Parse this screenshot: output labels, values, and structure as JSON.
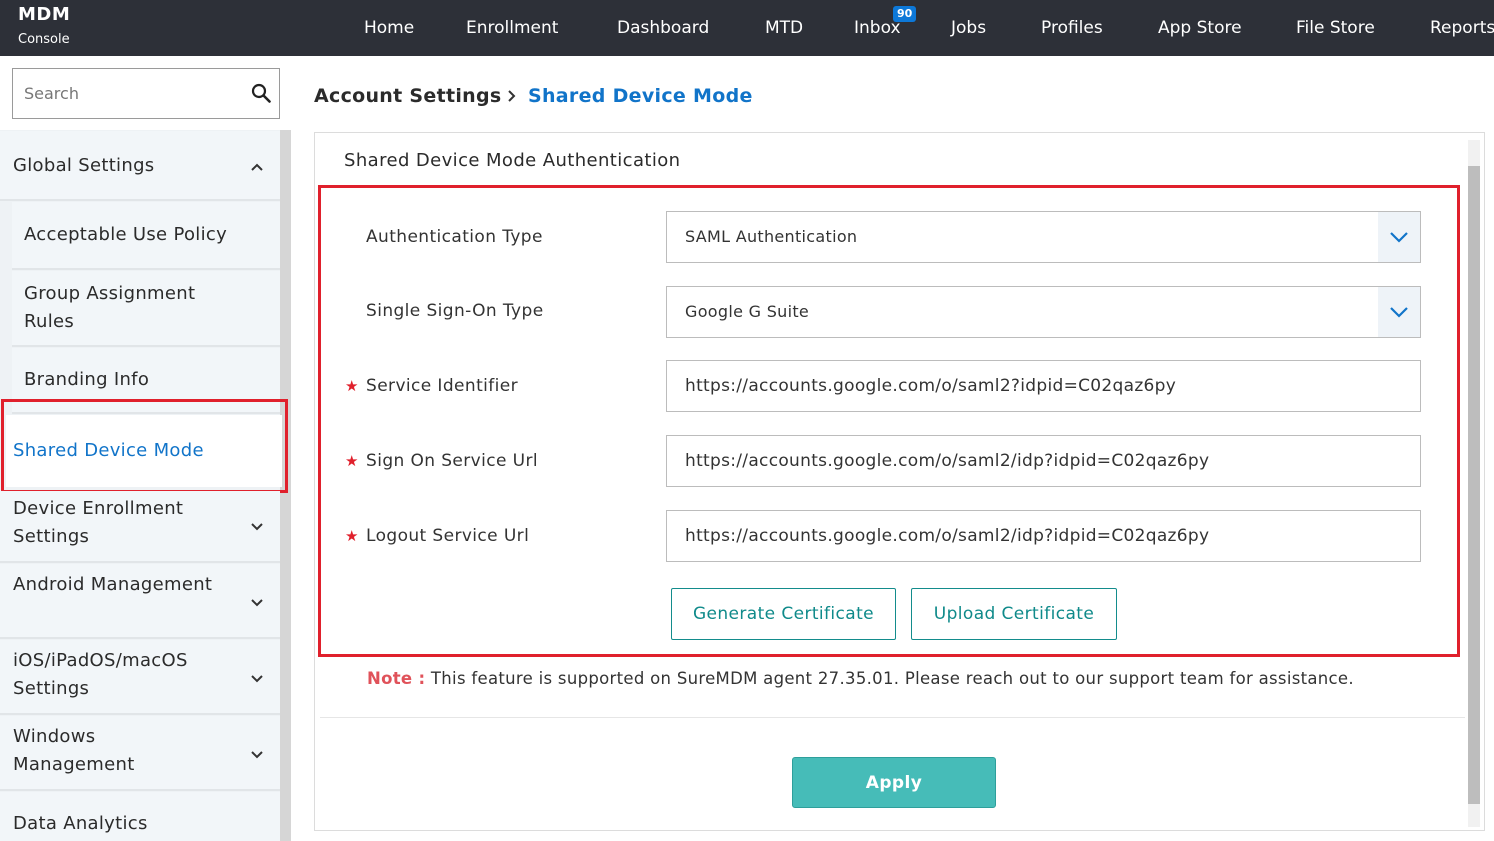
{
  "brand": {
    "title": "MDM",
    "subtitle": "Console"
  },
  "nav": {
    "items": [
      "Home",
      "Enrollment",
      "Dashboard",
      "MTD",
      "Inbox",
      "Jobs",
      "Profiles",
      "App Store",
      "File Store",
      "Reports"
    ],
    "inbox_badge": "90"
  },
  "sidebar": {
    "search_placeholder": "Search",
    "group_header": "Global Settings",
    "sub_items": [
      "Acceptable Use Policy",
      "Group Assignment Rules",
      "Branding Info",
      "Shared Device Mode"
    ],
    "active_item": "Shared Device Mode",
    "sections": [
      "Device Enrollment Settings",
      "Android Management",
      "iOS/iPadOS/macOS Settings",
      "Windows Management",
      "Data Analytics"
    ]
  },
  "breadcrumb": {
    "parent": "Account Settings",
    "current": "Shared Device Mode"
  },
  "panel": {
    "title": "Shared Device Mode Authentication",
    "fields": {
      "auth_type": {
        "label": "Authentication Type",
        "value": "SAML Authentication"
      },
      "sso_type": {
        "label": "Single Sign-On Type",
        "value": "Google G Suite"
      },
      "service_identifier": {
        "label": "Service Identifier",
        "value": "https://accounts.google.com/o/saml2?idpid=C02qaz6py",
        "required": true
      },
      "sign_on_url": {
        "label": "Sign On Service Url",
        "value": "https://accounts.google.com/o/saml2/idp?idpid=C02qaz6py",
        "required": true
      },
      "logout_url": {
        "label": "Logout Service Url",
        "value": "https://accounts.google.com/o/saml2/idp?idpid=C02qaz6py",
        "required": true
      }
    },
    "required_mark": "★",
    "generate_cert_label": "Generate Certificate",
    "upload_cert_label": "Upload Certificate",
    "note_label": "Note :",
    "note_text": "This feature is supported on SureMDM agent 27.35.01. Please reach out to our support team for assistance.",
    "apply_label": "Apply"
  },
  "colors": {
    "topbar": "#2d3038",
    "accent_blue": "#1174c9",
    "teal": "#46bcb8",
    "highlight_red": "#e0202c"
  }
}
